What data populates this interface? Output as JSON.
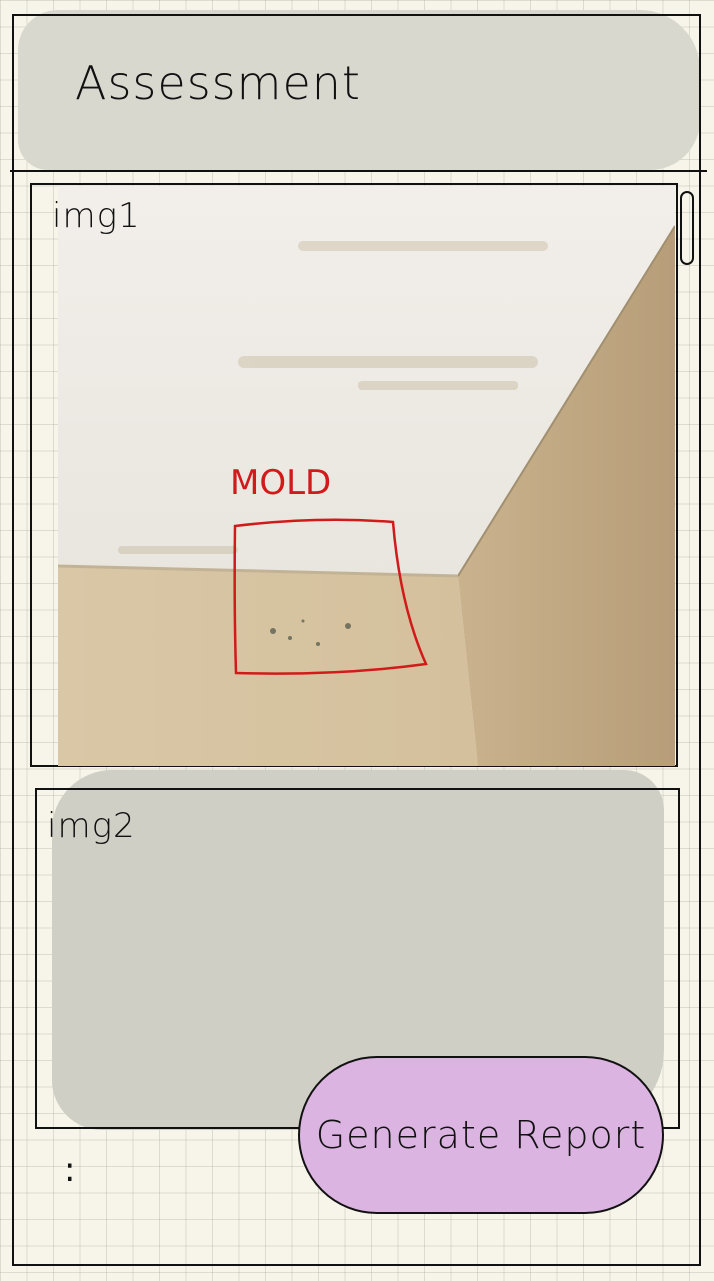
{
  "header": {
    "title": "Assessment"
  },
  "images": [
    {
      "label": "img1",
      "annotation": "MOLD",
      "annotation_color": "#d11a1a"
    },
    {
      "label": "img2"
    }
  ],
  "actions": {
    "generate_report_label": "Generate Report"
  },
  "more_indicator": ":",
  "colors": {
    "button_fill": "#dcb4e2",
    "shade": "#d8d8cf",
    "annotation": "#d11a1a"
  }
}
